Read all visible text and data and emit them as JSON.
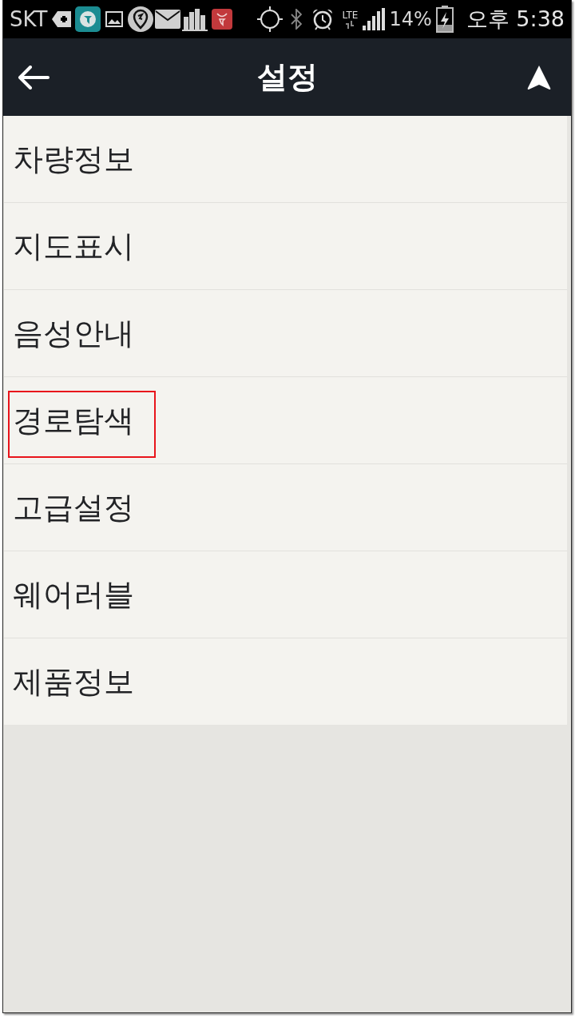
{
  "status_bar": {
    "carrier": "SKT",
    "network_type": "LTE",
    "battery": "14%",
    "time": "오후 5:38"
  },
  "app_bar": {
    "title": "설정"
  },
  "menu": {
    "items": [
      {
        "label": "차량정보",
        "highlighted": false
      },
      {
        "label": "지도표시",
        "highlighted": false
      },
      {
        "label": "음성안내",
        "highlighted": false
      },
      {
        "label": "경로탐색",
        "highlighted": true
      },
      {
        "label": "고급설정",
        "highlighted": false
      },
      {
        "label": "웨어러블",
        "highlighted": false
      },
      {
        "label": "제품정보",
        "highlighted": false
      }
    ]
  }
}
